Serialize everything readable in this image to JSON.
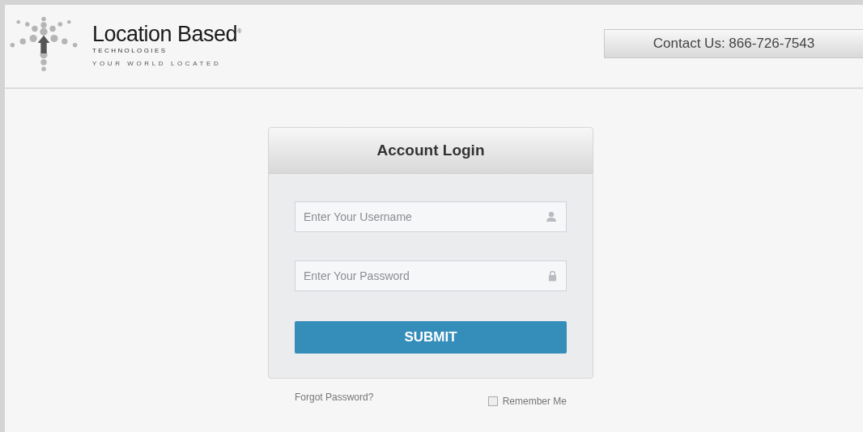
{
  "header": {
    "brand": "Location Based",
    "brand_mark": "®",
    "subtitle": "TECHNOLOGIES",
    "tagline": "YOUR WORLD LOCATED",
    "contact": "Contact Us: 866-726-7543"
  },
  "login": {
    "title": "Account Login",
    "fields": [
      {
        "kind": "username",
        "placeholder": "Enter Your Username"
      },
      {
        "kind": "password",
        "placeholder": "Enter Your Password"
      }
    ],
    "submit": "SUBMIT",
    "forgot": "Forgot Password?",
    "remember": {
      "label": "Remember Me",
      "checked": false
    }
  }
}
